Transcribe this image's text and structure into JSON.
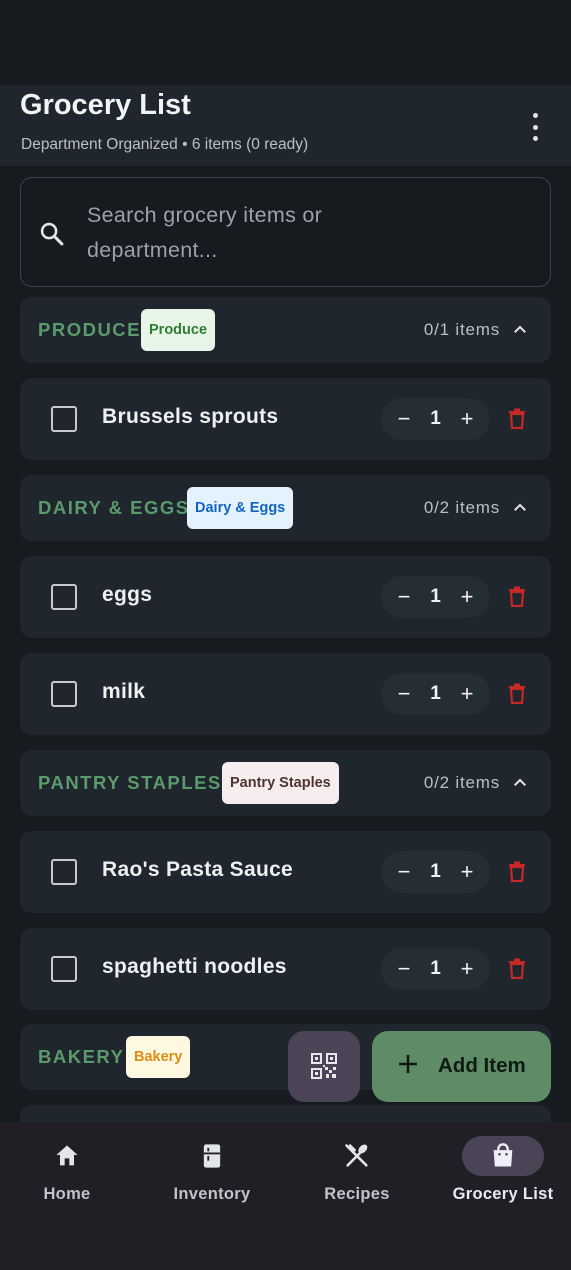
{
  "header": {
    "title": "Grocery List",
    "subtitle": "Department Organized • 6 items (0 ready)"
  },
  "search": {
    "placeholder": "Search grocery items or department..."
  },
  "departments": [
    {
      "name": "PRODUCE",
      "chip": "Produce",
      "chip_bg": "#e8f5e9",
      "chip_fg": "#2e7d32",
      "count": "0/1 items",
      "items": [
        {
          "name": "Brussels sprouts",
          "qty": "1",
          "checked": false
        }
      ]
    },
    {
      "name": "DAIRY & EGGS",
      "chip": "Dairy & Eggs",
      "chip_bg": "#e3f2fd",
      "chip_fg": "#1565c0",
      "count": "0/2 items",
      "items": [
        {
          "name": "eggs",
          "qty": "1",
          "checked": false
        },
        {
          "name": "milk",
          "qty": "1",
          "checked": false
        }
      ]
    },
    {
      "name": "PANTRY STAPLES",
      "chip": "Pantry Staples",
      "chip_bg": "#f6eeee",
      "chip_fg": "#4e342e",
      "count": "0/2 items",
      "items": [
        {
          "name": "Rao's Pasta Sauce",
          "qty": "1",
          "checked": false
        },
        {
          "name": "spaghetti noodles",
          "qty": "1",
          "checked": false
        }
      ]
    },
    {
      "name": "BAKERY",
      "chip": "Bakery",
      "chip_bg": "#fff8e1",
      "chip_fg": "#e08b12",
      "count": "",
      "items": []
    }
  ],
  "fab": {
    "add_label": "Add Item"
  },
  "nav": [
    {
      "label": "Home",
      "icon": "home-icon",
      "active": false
    },
    {
      "label": "Inventory",
      "icon": "fridge-icon",
      "active": false
    },
    {
      "label": "Recipes",
      "icon": "utensils-icon",
      "active": false
    },
    {
      "label": "Grocery List",
      "icon": "shopping-bag-icon",
      "active": true
    }
  ],
  "colors": {
    "accent": "#5a9a6c",
    "fab_add": "#5e8c66",
    "fab_qr": "#4a4456",
    "delete": "#c62828",
    "nav_active_pill": "#4a4456"
  }
}
